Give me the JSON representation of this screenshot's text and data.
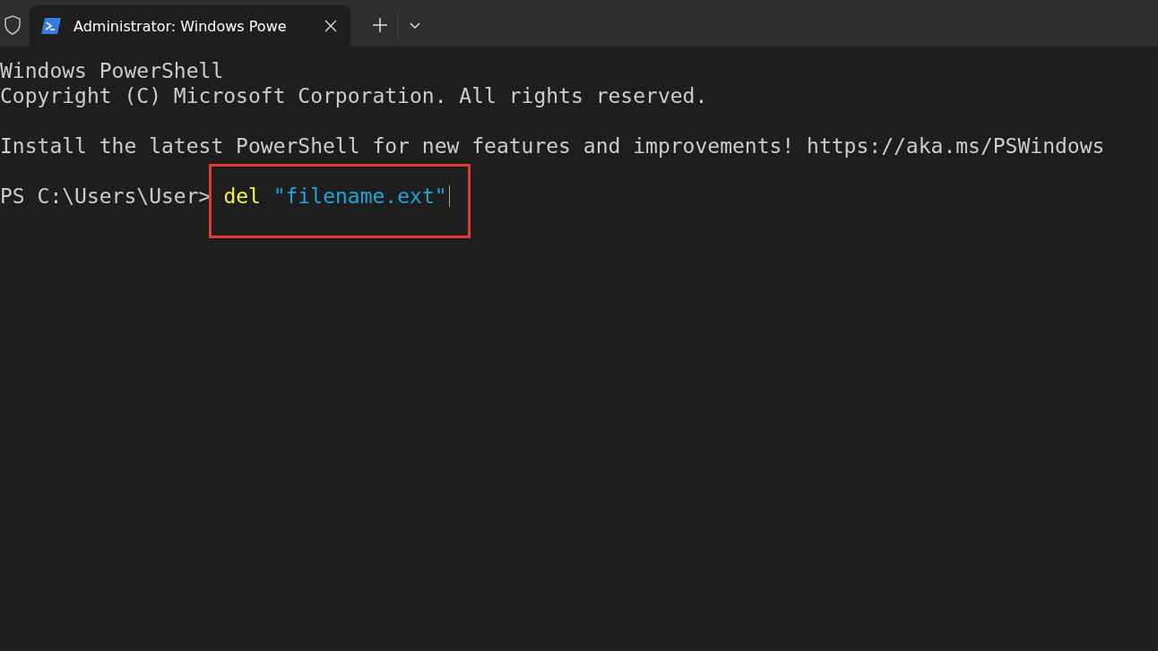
{
  "tabs": [
    {
      "title": "Administrator: Windows Powe",
      "selected": true
    }
  ],
  "terminal": {
    "blocks": [
      [
        "Windows PowerShell",
        "Copyright (C) Microsoft Corporation. All rights reserved."
      ],
      [
        "Install the latest PowerShell for new features and improvements! https://aka.ms/PSWindows"
      ]
    ],
    "prompt": "PS C:\\Users\\User>",
    "command": [
      {
        "kind": "keyword",
        "text": "del"
      },
      {
        "kind": "string",
        "text": "\"filename.ext\""
      }
    ],
    "highlighted": true
  }
}
